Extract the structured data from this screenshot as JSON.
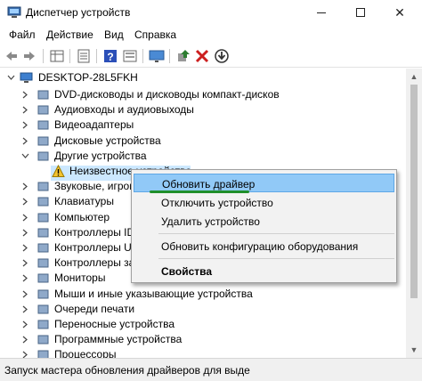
{
  "window": {
    "title": "Диспетчер устройств",
    "controls": {
      "minimize": "—",
      "maximize": "☐",
      "close": "✕"
    }
  },
  "menu": [
    "Файл",
    "Действие",
    "Вид",
    "Справка"
  ],
  "toolbar": {
    "icons": [
      "back-arrow-icon",
      "forward-arrow-icon",
      "properties-grid-icon",
      "list-view-icon",
      "help-icon",
      "device-view-icon",
      "monitor-icon",
      "update-driver-icon",
      "uninstall-x-icon",
      "download-icon"
    ],
    "colors": {
      "delete": "#cc1f1f",
      "help": "#2b4fb8",
      "update": "#2e7d32"
    }
  },
  "tree": {
    "root": "DESKTOP-28L5FKH",
    "items": [
      {
        "label": "DVD-дисководы и дисководы компакт-дисков",
        "icon": "dvd-drive-icon"
      },
      {
        "label": "Аудиовходы и аудиовыходы",
        "icon": "speaker-icon"
      },
      {
        "label": "Видеоадаптеры",
        "icon": "display-adapter-icon"
      },
      {
        "label": "Дисковые устройства",
        "icon": "disk-drive-icon"
      },
      {
        "label": "Другие устройства",
        "icon": "unknown-device-icon",
        "expanded": true
      },
      {
        "label": "Неизвестное устройство",
        "icon": "warning-icon",
        "child": true,
        "selected": true
      },
      {
        "label": "Звуковые, игрово",
        "icon": "sound-icon"
      },
      {
        "label": "Клавиатуры",
        "icon": "keyboard-icon"
      },
      {
        "label": "Компьютер",
        "icon": "computer-icon"
      },
      {
        "label": "Контроллеры ID",
        "icon": "ide-controller-icon"
      },
      {
        "label": "Контроллеры US",
        "icon": "usb-controller-icon"
      },
      {
        "label": "Контроллеры за",
        "icon": "storage-controller-icon"
      },
      {
        "label": "Мониторы",
        "icon": "monitor-icon"
      },
      {
        "label": "Мыши и иные указывающие устройства",
        "icon": "mouse-icon"
      },
      {
        "label": "Очереди печати",
        "icon": "print-queue-icon"
      },
      {
        "label": "Переносные устройства",
        "icon": "portable-device-icon"
      },
      {
        "label": "Программные устройства",
        "icon": "software-device-icon"
      },
      {
        "label": "Процессоры",
        "icon": "processor-icon"
      }
    ]
  },
  "context_menu": {
    "items": [
      {
        "label": "Обновить драйвер",
        "highlighted": true
      },
      {
        "label": "Отключить устройство"
      },
      {
        "label": "Удалить устройство"
      },
      {
        "label": "Обновить конфигурацию оборудования"
      },
      {
        "label": "Свойства",
        "bold": true
      }
    ],
    "highlight_color": "#91c9f7",
    "underline_color": "#1f8f2a"
  },
  "status": {
    "text": "Запуск мастера обновления драйверов для выде"
  }
}
